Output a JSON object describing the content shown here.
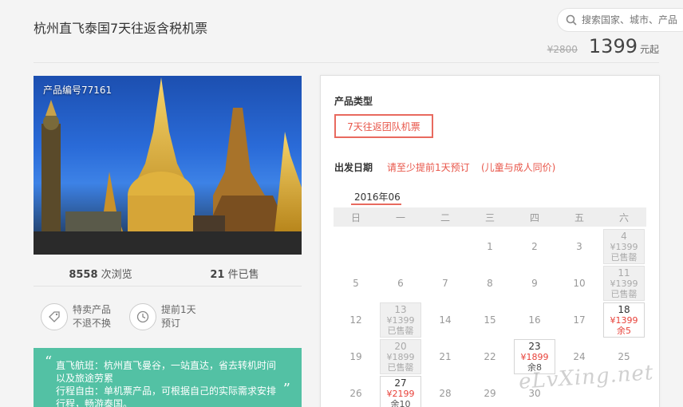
{
  "title": "杭州直飞泰国7天往返含税机票",
  "search": {
    "placeholder": "搜索国家、城市、产品"
  },
  "price": {
    "old": "¥2800",
    "current": "1399",
    "unit": "元起"
  },
  "product": {
    "code_label": "产品编号77161"
  },
  "stats": {
    "views_count": "8558",
    "views_label": "次浏览",
    "sold_count": "21",
    "sold_label": "件已售"
  },
  "features": [
    {
      "icon": "tag-icon",
      "line1": "特卖产品",
      "line2": "不退不换"
    },
    {
      "icon": "clock-icon",
      "line1": "提前1天",
      "line2": "预订"
    }
  ],
  "notes": {
    "line1": "直飞航班：杭州直飞曼谷，一站直达，省去转机时间",
    "line2": "以及旅途劳累",
    "line3": "行程自由：单机票产品，可根据自己的实际需求安排",
    "line4": "行程，畅游泰国。"
  },
  "booking": {
    "type_label": "产品类型",
    "type_option": "7天往返团队机票",
    "date_label": "出发日期",
    "hint1": "请至少提前1天预订",
    "hint2": "(儿童与成人同价)",
    "month": "2016年06",
    "weekdays": [
      "日",
      "一",
      "二",
      "三",
      "四",
      "五",
      "六"
    ],
    "days": [
      {
        "day": ""
      },
      {
        "day": ""
      },
      {
        "day": ""
      },
      {
        "day": "1"
      },
      {
        "day": "2"
      },
      {
        "day": "3"
      },
      {
        "day": "4",
        "price": "¥1399",
        "status": "已售罄",
        "state": "soldout"
      },
      {
        "day": "5"
      },
      {
        "day": "6"
      },
      {
        "day": "7"
      },
      {
        "day": "8"
      },
      {
        "day": "9"
      },
      {
        "day": "10"
      },
      {
        "day": "11",
        "price": "¥1399",
        "status": "已售罄",
        "state": "soldout"
      },
      {
        "day": "12"
      },
      {
        "day": "13",
        "price": "¥1399",
        "status": "已售罄",
        "state": "soldout"
      },
      {
        "day": "14"
      },
      {
        "day": "15"
      },
      {
        "day": "16"
      },
      {
        "day": "17"
      },
      {
        "day": "18",
        "price": "¥1399",
        "status": "余5",
        "state": "avail"
      },
      {
        "day": "19"
      },
      {
        "day": "20",
        "price": "¥1899",
        "status": "已售罄",
        "state": "soldout"
      },
      {
        "day": "21"
      },
      {
        "day": "22"
      },
      {
        "day": "23",
        "price": "¥1899",
        "status": "余8",
        "state": "avail"
      },
      {
        "day": "24"
      },
      {
        "day": "25"
      },
      {
        "day": "26"
      },
      {
        "day": "27",
        "price": "¥2199",
        "status": "余10",
        "state": "avail"
      },
      {
        "day": "28"
      },
      {
        "day": "29"
      },
      {
        "day": "30"
      }
    ]
  },
  "watermark": "eLvXing.net"
}
